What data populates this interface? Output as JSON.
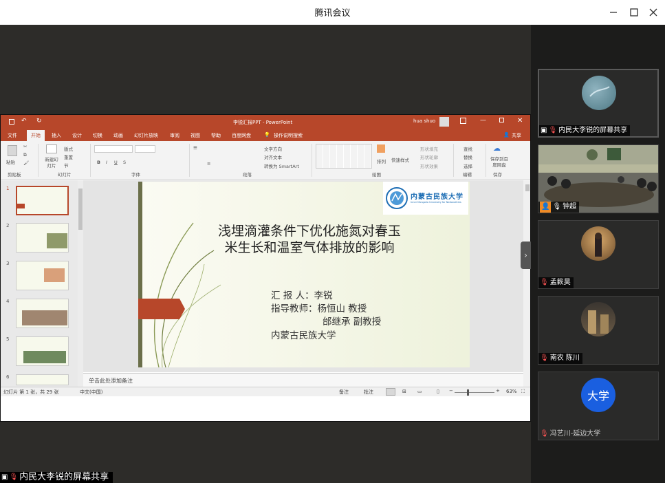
{
  "app_title": "腾讯会议",
  "ppt": {
    "doc_title": "李锐汇报PPT - PowerPoint",
    "user": "hua shuo",
    "share_label": "共享",
    "tabs": [
      "文件",
      "开始",
      "插入",
      "设计",
      "切换",
      "动画",
      "幻灯片放映",
      "审阅",
      "视图",
      "帮助",
      "百度网盘",
      "操作说明搜索"
    ],
    "active_tab": "开始",
    "ribbon": {
      "paste": "粘贴",
      "new_slide": "新建幻灯片",
      "layout": "版式",
      "reset": "重置",
      "section": "节",
      "text_direction": "文字方向",
      "align_text": "对齐文本",
      "smartart": "转换为 SmartArt",
      "arrange": "排列",
      "quick_styles": "快速样式",
      "shape_fill": "形状填充",
      "shape_outline": "形状轮廓",
      "shape_effects": "形状效果",
      "find": "查找",
      "replace": "替换",
      "select": "选择",
      "save_baidu": "保存到百度网盘",
      "groups": [
        "剪贴板",
        "幻灯片",
        "字体",
        "段落",
        "绘图",
        "编辑",
        "保存"
      ]
    },
    "thumb_numbers": [
      "1",
      "2",
      "3",
      "4",
      "5",
      "6"
    ],
    "slide": {
      "title_line1": "浅埋滴灌条件下优化施氮对春玉",
      "title_line2": "米生长和温室气体排放的影响",
      "reporter": "汇 报 人：李锐",
      "advisor1": "指导教师：杨恒山  教授",
      "advisor2": "邰继承  副教授",
      "university": "内蒙古民族大学",
      "logo_text": "内蒙古民族大学",
      "logo_subtext": "Inner Mongolia University for Nationalities"
    },
    "notes_placeholder": "单击此处添加备注",
    "status": {
      "slide_counter": "幻灯片 第 1 张，共 29 张",
      "language": "中文(中国)",
      "notes": "备注",
      "comments": "批注",
      "zoom": "63%"
    }
  },
  "shared_screen_label": "内民大李锐的屏幕共享",
  "participants": [
    {
      "name": "内民大李锐的屏幕共享"
    },
    {
      "name": "钟超"
    },
    {
      "name": "孟簌昊"
    },
    {
      "name": "南农 陈川"
    },
    {
      "name": "冯艺川-延边大学",
      "avatar_text": "大学"
    }
  ],
  "colors": {
    "ppt_accent": "#b7472a",
    "avatar_blue": "#1a5fe0"
  }
}
